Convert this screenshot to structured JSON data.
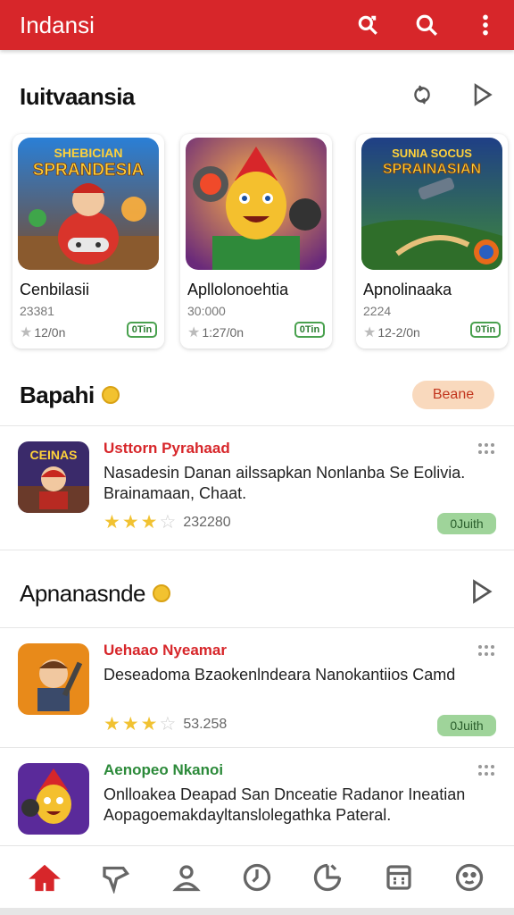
{
  "appbar": {
    "title": "Indansi",
    "icons": [
      "refresh-search-icon",
      "search-icon",
      "more-vert-icon"
    ]
  },
  "featured": {
    "title": "Iuitvaansia",
    "cards": [
      {
        "name": "Cenbilasii",
        "sub": "23381",
        "meta": "12/0n",
        "badge": "0Tin",
        "art_title": "SPRANDESIA",
        "art_kicker": "SHEBICIAN"
      },
      {
        "name": "Apllolonoehtia",
        "sub": "30:000",
        "meta": "1:27/0n",
        "badge": "0Tin",
        "art_title": "",
        "art_kicker": ""
      },
      {
        "name": "Apnolinaaka",
        "sub": "2224",
        "meta": "12-2/0n",
        "badge": "0Tin",
        "art_title": "SPRAINASIAN",
        "art_kicker": "SUNIA SOCUS"
      }
    ]
  },
  "section2": {
    "title": "Bapahi",
    "button": "Beane"
  },
  "item1": {
    "name": "Usttorn Pyrahaad",
    "desc": "Nasadesin Danan ailssapkan Nonlanba Se Eolivia. Brainamaan, Chaat.",
    "count": "232280",
    "badge": "0Juith",
    "thumb_label": "CEINAS"
  },
  "section3": {
    "title": "Apnanasnde"
  },
  "item2": {
    "name": "Uehaao Nyeamar",
    "desc": "Deseadoma Bzaokenlndeara Nanokantiios Camd",
    "count": "53.258",
    "badge": "0Juith"
  },
  "item3": {
    "name": "Aenopeo Nkanoi",
    "desc": "Onlloakea Deapad San Dnceatie Radanor Ineatian Aopagoemakdayltanslolegathka Pateral."
  },
  "colors": {
    "brand": "#d7262a",
    "star": "#f1c232",
    "badge": "#9fd49a"
  }
}
